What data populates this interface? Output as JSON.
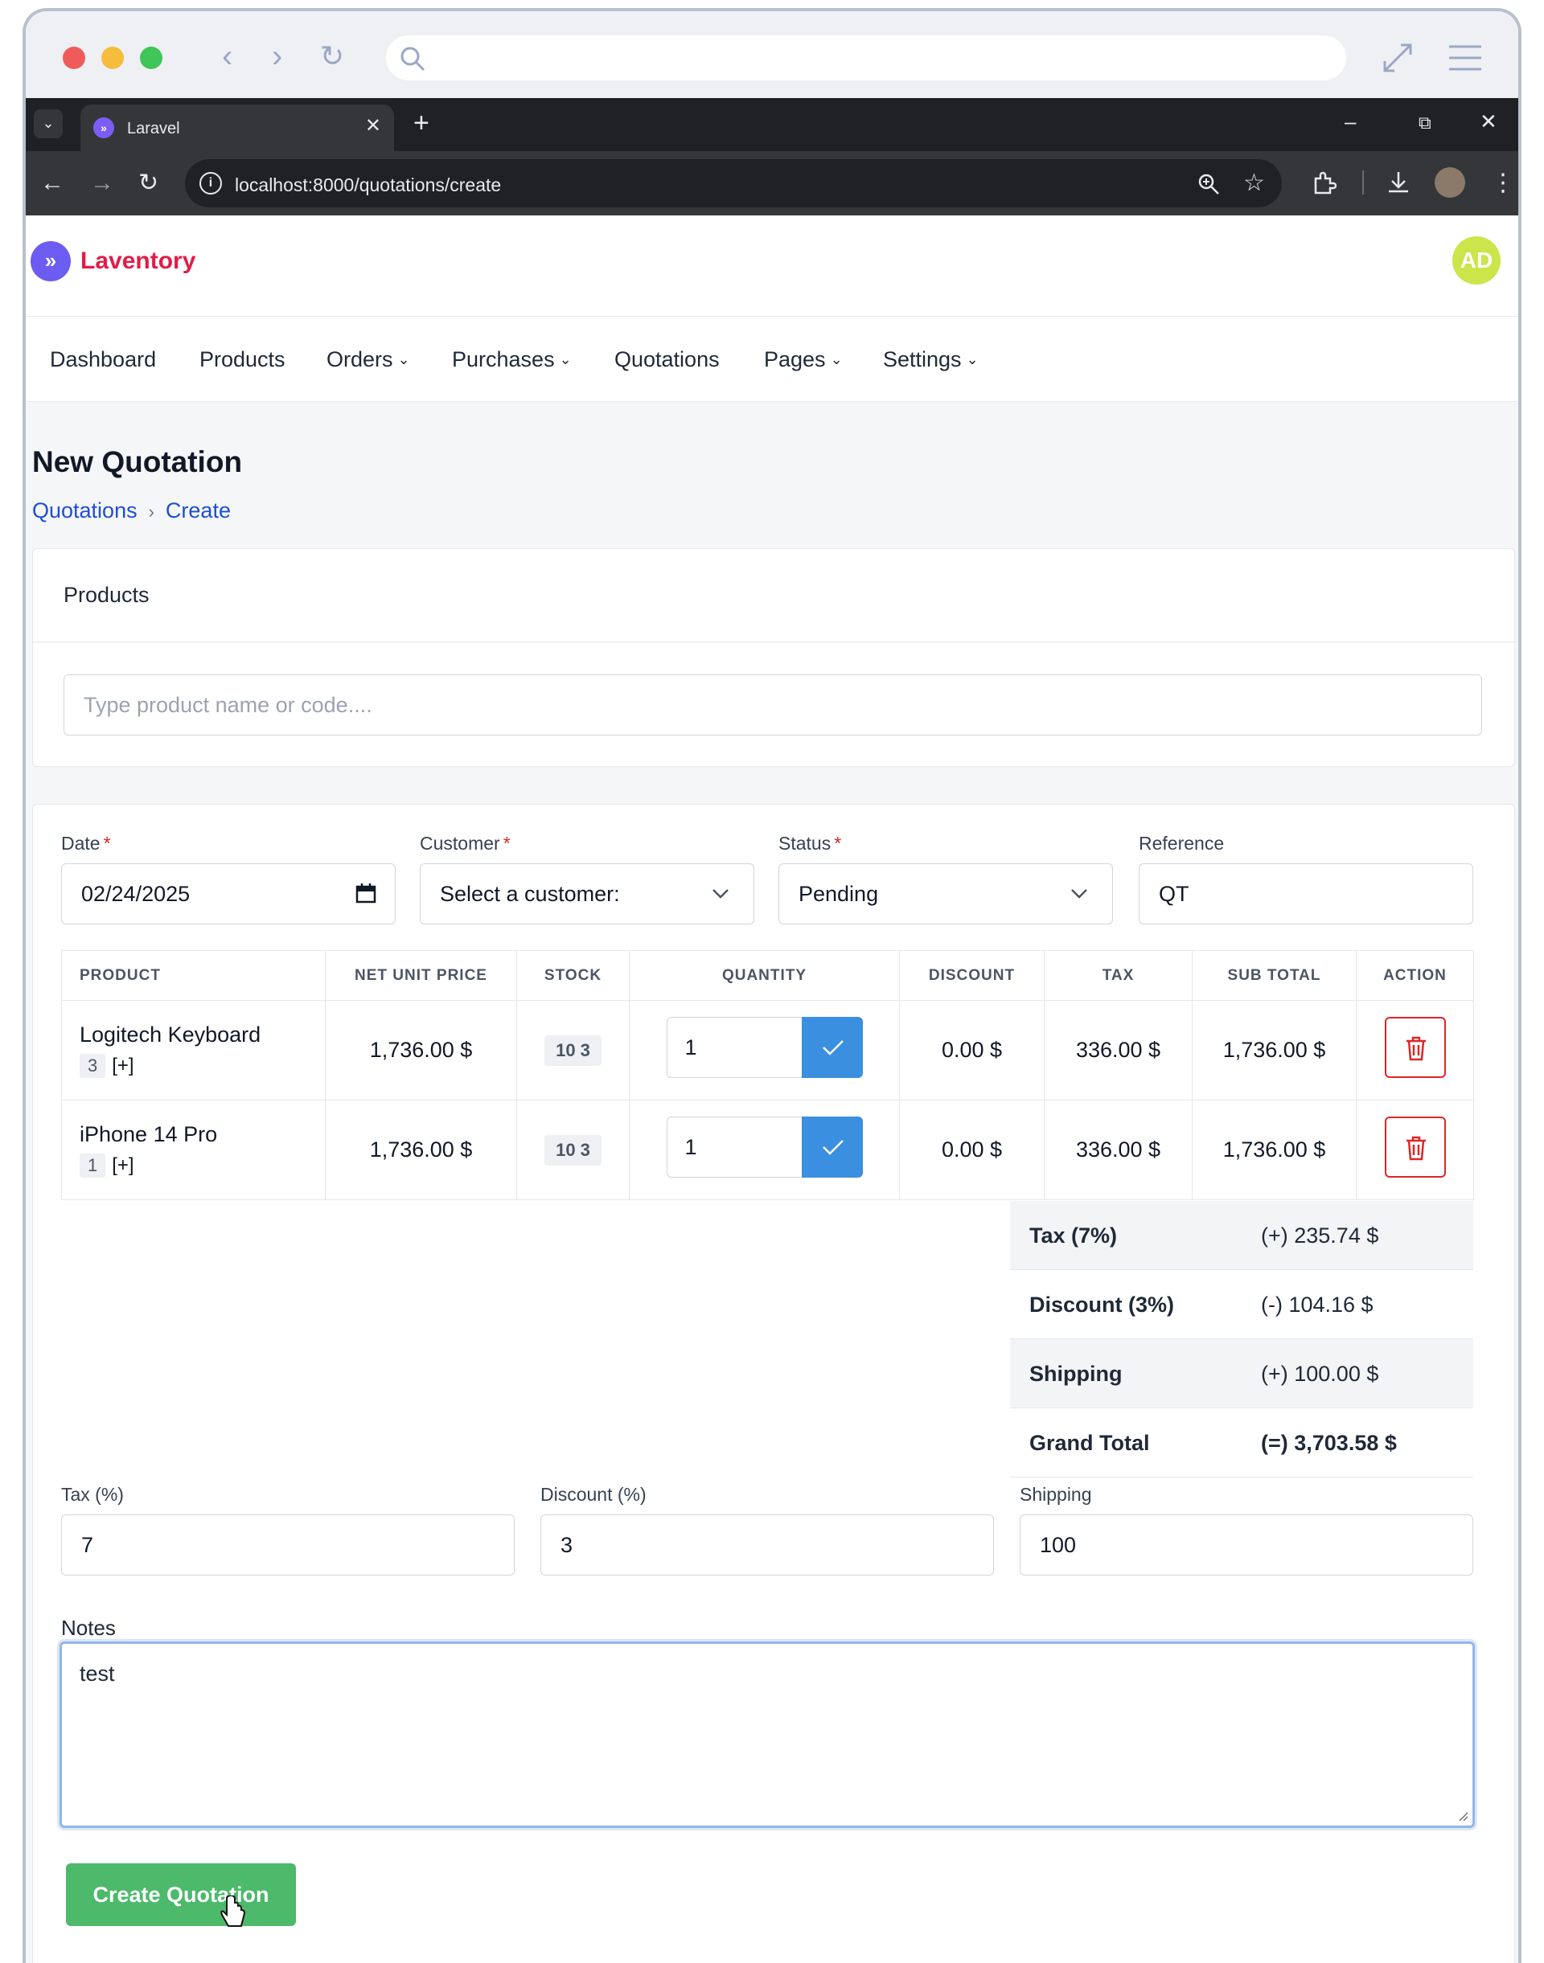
{
  "browser": {
    "tab_title": "Laravel",
    "url": "localhost:8000/quotations/create"
  },
  "app": {
    "brand": "Laventory",
    "avatar_initials": "AD",
    "nav": {
      "dashboard": "Dashboard",
      "products": "Products",
      "orders": "Orders",
      "purchases": "Purchases",
      "quotations": "Quotations",
      "pages": "Pages",
      "settings": "Settings"
    }
  },
  "page": {
    "title": "New Quotation",
    "breadcrumb": [
      "Quotations",
      "Create"
    ]
  },
  "products_card": {
    "header": "Products",
    "search_placeholder": "Type product name or code...."
  },
  "form": {
    "date_label": "Date",
    "date_value": "02/24/2025",
    "customer_label": "Customer",
    "customer_value": "Select a customer:",
    "status_label": "Status",
    "status_value": "Pending",
    "reference_label": "Reference",
    "reference_value": "QT",
    "required_mark": "*"
  },
  "table": {
    "headers": [
      "PRODUCT",
      "NET UNIT PRICE",
      "STOCK",
      "QUANTITY",
      "DISCOUNT",
      "TAX",
      "SUB TOTAL",
      "ACTION"
    ],
    "rows": [
      {
        "name": "Logitech Keyboard",
        "code": "3",
        "add": "[+]",
        "price": "1,736.00 $",
        "stock": "10 3",
        "quantity": "1",
        "discount": "0.00 $",
        "tax": "336.00 $",
        "subtotal": "1,736.00 $"
      },
      {
        "name": "iPhone 14 Pro",
        "code": "1",
        "add": "[+]",
        "price": "1,736.00 $",
        "stock": "10 3",
        "quantity": "1",
        "discount": "0.00 $",
        "tax": "336.00 $",
        "subtotal": "1,736.00 $"
      }
    ]
  },
  "summary": {
    "tax_label": "Tax (7%)",
    "tax_value": "(+) 235.74 $",
    "discount_label": "Discount (3%)",
    "discount_value": "(-) 104.16 $",
    "shipping_label": "Shipping",
    "shipping_value": "(+) 100.00 $",
    "grand_total_label": "Grand Total",
    "grand_total_value": "(=) 3,703.58 $"
  },
  "adjustments": {
    "tax_label": "Tax (%)",
    "tax_value": "7",
    "discount_label": "Discount (%)",
    "discount_value": "3",
    "shipping_label": "Shipping",
    "shipping_value": "100"
  },
  "notes": {
    "label": "Notes",
    "value": "test"
  },
  "submit_label": "Create Quotation"
}
